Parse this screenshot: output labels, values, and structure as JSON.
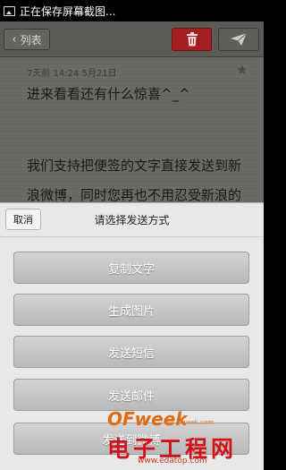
{
  "status_bar": {
    "text": "正在保存屏幕截图...",
    "icon": "image-icon"
  },
  "app_bar": {
    "back_label": "列表",
    "delete_icon": "trash-icon",
    "send_icon": "paper-plane-icon",
    "colors": {
      "bar": "#5c5a57",
      "delete": "#a41f1f"
    }
  },
  "note": {
    "date": "7天前   14:24  5月21日",
    "lines": [
      "进来看看还有什么惊喜^_^",
      "我们支持把便签的文字直接发送到新",
      "浪微博，同时您再也不用忍受新浪的"
    ],
    "star_icon": "star-icon"
  },
  "share_sheet": {
    "cancel_label": "取消",
    "title": "请选择发送方式",
    "options": [
      "复制文字",
      "生成图片",
      "发送短信",
      "发送邮件",
      "发送到微博"
    ]
  },
  "watermark": {
    "brand": "OFweek",
    "cn": "电子工程网",
    "url_top": "ee.ofweek.com",
    "url": "www.edatop.com"
  }
}
